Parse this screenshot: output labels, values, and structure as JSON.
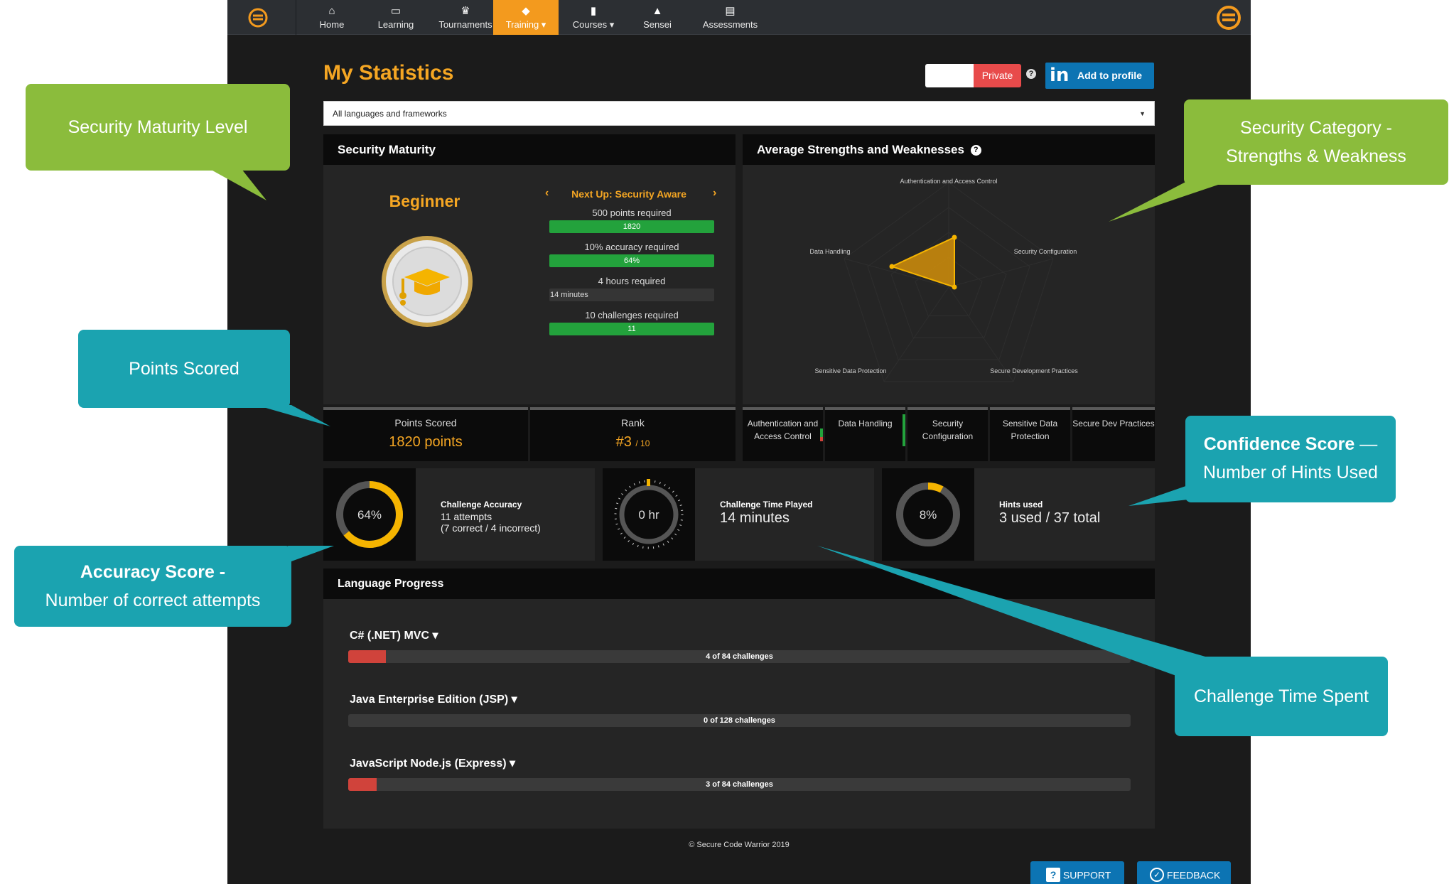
{
  "nav": {
    "items": [
      {
        "label": "Home",
        "icon": "home-icon"
      },
      {
        "label": "Learning",
        "icon": "monitor-icon"
      },
      {
        "label": "Tournaments",
        "icon": "trophy-icon"
      },
      {
        "label": "Training ▾",
        "icon": "graduation-cap-icon"
      },
      {
        "label": "Courses ▾",
        "icon": "book-icon"
      },
      {
        "label": "Sensei",
        "icon": "sensei-hat-icon"
      },
      {
        "label": "Assessments",
        "icon": "document-icon"
      }
    ],
    "active": "Training"
  },
  "page": {
    "title": "My Statistics",
    "privacy_label": "Private",
    "help": "?",
    "linkedin_icon": "in",
    "linkedin_label": "Add to profile",
    "filter_value": "All languages and frameworks"
  },
  "security_maturity": {
    "header": "Security Maturity",
    "level": "Beginner",
    "next_up": "Next Up: Security Aware",
    "requirements": [
      {
        "label": "500 points required",
        "value": "1820",
        "style": "green"
      },
      {
        "label": "10% accuracy required",
        "value": "64%",
        "style": "green"
      },
      {
        "label": "4 hours required",
        "value": "14 minutes",
        "style": "dark"
      },
      {
        "label": "10 challenges required",
        "value": "11",
        "style": "green"
      }
    ],
    "points_label": "Points Scored",
    "points_value": "1820 points",
    "rank_label": "Rank",
    "rank_value": "#3",
    "rank_total": "/ 10"
  },
  "strengths": {
    "header": "Average Strengths and Weaknesses",
    "axes": [
      "Authentication and Access Control",
      "Security Configuration",
      "Secure Development Practices",
      "Sensitive Data Protection",
      "Data Handling"
    ],
    "cells": [
      "Authentication and Access Control",
      "Data Handling",
      "Security Configuration",
      "Sensitive Data Protection",
      "Secure Dev Practices"
    ]
  },
  "metrics": [
    {
      "ring": "64%",
      "label": "Challenge Accuracy",
      "line1": "11 attempts",
      "line2": "(7 correct / 4 incorrect)"
    },
    {
      "ring": "0 hr",
      "label": "Challenge Time Played",
      "line1": "14 minutes"
    },
    {
      "ring": "8%",
      "label": "Hints used",
      "line1": "3 used / 37 total"
    }
  ],
  "language_progress": {
    "header": "Language Progress",
    "items": [
      {
        "name": "C# (.NET) MVC ▾",
        "progress": "4 of 84 challenges",
        "fraction": 0.048
      },
      {
        "name": "Java Enterprise Edition (JSP) ▾",
        "progress": "0 of 128 challenges",
        "fraction": 0
      },
      {
        "name": "JavaScript Node.js (Express) ▾",
        "progress": "3 of 84 challenges",
        "fraction": 0.036
      }
    ]
  },
  "footer": {
    "copyright": "© Secure Code Warrior 2019",
    "support": "SUPPORT",
    "feedback": "FEEDBACK"
  },
  "callouts": {
    "security_maturity": "Security Maturity Level",
    "category_line1": "Security Category  -",
    "category_line2": "Strengths & Weakness",
    "points": "Points Scored",
    "confidence_bold": "Confidence Score",
    "confidence_dash": " —",
    "confidence_line2": "Number of Hints Used",
    "accuracy_bold": "Accuracy Score -",
    "accuracy_line2": "Number of correct attempts",
    "time": "Challenge Time Spent"
  },
  "colors": {
    "accent": "#f5a623",
    "green": "#23a23c",
    "callout_green": "#8bbc3c",
    "callout_teal": "#1ba3b0",
    "linkedin": "#0c74b3"
  }
}
